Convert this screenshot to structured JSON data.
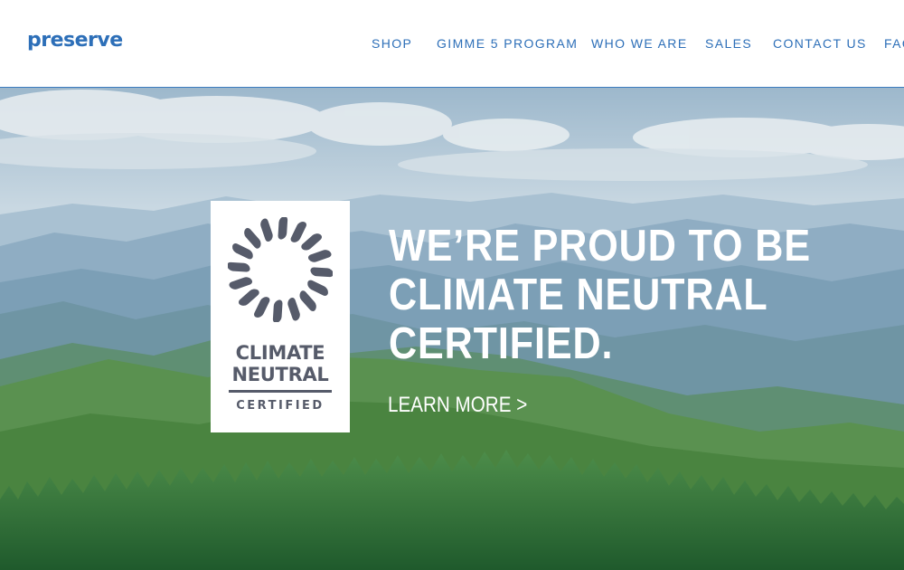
{
  "brand": {
    "logo_text": "preserve",
    "color": "#2d6fb8"
  },
  "nav": {
    "items": [
      {
        "label": "SHOP"
      },
      {
        "label": "GIMME 5 PROGRAM"
      },
      {
        "label": "WHO WE ARE"
      },
      {
        "label": "SALES"
      },
      {
        "label": "CONTACT US"
      },
      {
        "label": "FAQ"
      }
    ]
  },
  "hero": {
    "badge": {
      "line1": "CLIMATE",
      "line2": "NEUTRAL",
      "line3": "CERTIFIED",
      "icon": "sun-burst-icon",
      "color": "#565b6a"
    },
    "headline": [
      "WE’RE PROUD TO BE",
      "CLIMATE NEUTRAL",
      "CERTIFIED."
    ],
    "cta": "LEARN MORE >",
    "background": "mountain-landscape"
  }
}
